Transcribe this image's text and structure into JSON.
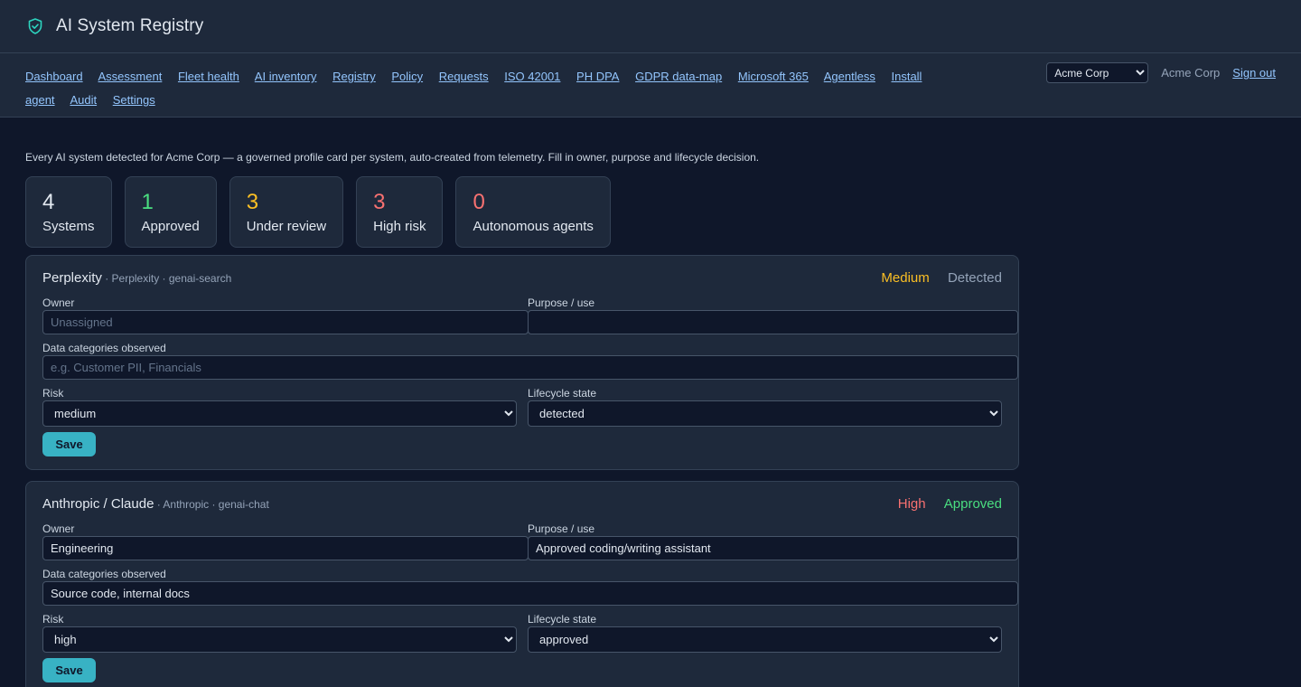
{
  "app": {
    "title": "AI System Registry",
    "logo_icon": "shield-check-icon"
  },
  "nav": {
    "links": [
      "Dashboard",
      "Assessment",
      "Fleet health",
      "AI inventory",
      "Registry",
      "Policy",
      "Requests",
      "ISO 42001",
      "PH DPA",
      "GDPR data-map",
      "Microsoft 365",
      "Agentless",
      "Install agent",
      "Audit",
      "Settings"
    ],
    "org_selected": "Acme Corp",
    "org_name": "Acme Corp",
    "sign_out": "Sign out"
  },
  "intro": "Every AI system detected for Acme Corp — a governed profile card per system, auto-created from telemetry. Fill in owner, purpose and lifecycle decision.",
  "stats": [
    {
      "value": "4",
      "label": "Systems",
      "color": "#e2e8f0"
    },
    {
      "value": "1",
      "label": "Approved",
      "color": "#4ade80"
    },
    {
      "value": "3",
      "label": "Under review",
      "color": "#fbbf24"
    },
    {
      "value": "3",
      "label": "High risk",
      "color": "#f87171"
    },
    {
      "value": "0",
      "label": "Autonomous agents",
      "color": "#f87171"
    }
  ],
  "labels": {
    "owner": "Owner",
    "purpose": "Purpose / use",
    "data_categories": "Data categories observed",
    "risk": "Risk",
    "lifecycle": "Lifecycle state",
    "save": "Save"
  },
  "cards": [
    {
      "name": "Perplexity",
      "meta": " · Perplexity · genai-search",
      "risk_badge": "Medium",
      "risk_color": "#fbbf24",
      "state_badge": "Detected",
      "state_color": "#94a3b8",
      "owner": "",
      "owner_placeholder": "Unassigned",
      "purpose": "",
      "data_categories": "",
      "data_placeholder": "e.g. Customer PII, Financials",
      "risk": "medium",
      "lifecycle": "detected"
    },
    {
      "name": "Anthropic / Claude",
      "meta": " · Anthropic · genai-chat",
      "risk_badge": "High",
      "risk_color": "#f87171",
      "state_badge": "Approved",
      "state_color": "#4ade80",
      "owner": "Engineering",
      "owner_placeholder": "Unassigned",
      "purpose": "Approved coding/writing assistant",
      "data_categories": "Source code, internal docs",
      "data_placeholder": "e.g. Customer PII, Financials",
      "risk": "high",
      "lifecycle": "approved"
    }
  ]
}
